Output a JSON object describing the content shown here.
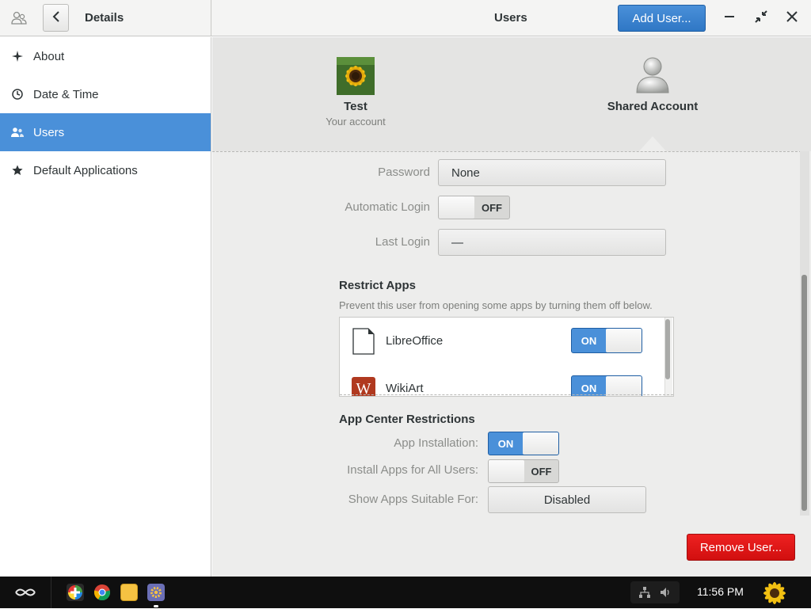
{
  "header": {
    "left_title": "Details",
    "center_title": "Users",
    "add_user_label": "Add User..."
  },
  "sidebar": {
    "items": [
      {
        "label": "About",
        "icon": "sparkle-icon"
      },
      {
        "label": "Date & Time",
        "icon": "clock-icon"
      },
      {
        "label": "Users",
        "icon": "users-icon",
        "active": true
      },
      {
        "label": "Default Applications",
        "icon": "star-icon"
      }
    ]
  },
  "accounts": [
    {
      "name": "Test",
      "subtitle": "Your account"
    },
    {
      "name": "Shared Account",
      "selected": true
    }
  ],
  "details": {
    "password_label": "Password",
    "password_value": "None",
    "autologin_label": "Automatic Login",
    "autologin_state": "OFF",
    "lastlogin_label": "Last Login",
    "lastlogin_value": "—"
  },
  "restrict_apps": {
    "title": "Restrict Apps",
    "description": "Prevent this user from opening some apps by turning them off below.",
    "apps": [
      {
        "name": "LibreOffice",
        "state": "ON"
      },
      {
        "name": "WikiArt",
        "state": "ON"
      }
    ]
  },
  "app_center": {
    "title": "App Center Restrictions",
    "install_label": "App Installation:",
    "install_state": "ON",
    "all_users_label": "Install Apps for All Users:",
    "all_users_state": "OFF",
    "suitable_label": "Show Apps Suitable For:",
    "suitable_value": "Disabled"
  },
  "remove_user_label": "Remove User...",
  "taskbar": {
    "clock": "11:56 PM"
  },
  "colors": {
    "accent": "#4a90d9",
    "destructive": "#e01b1b",
    "taskbar": "#0f0f0f"
  }
}
